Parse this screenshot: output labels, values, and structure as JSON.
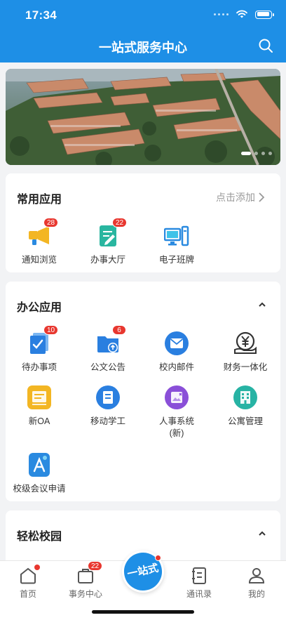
{
  "status_bar": {
    "time": "17:34"
  },
  "nav": {
    "title": "一站式服务中心"
  },
  "banner": {
    "slides": 4,
    "active": 1
  },
  "common_apps": {
    "title": "常用应用",
    "action": "点击添加",
    "items": [
      {
        "label": "通知浏览",
        "badge": "28",
        "icon": "megaphone-icon"
      },
      {
        "label": "办事大厅",
        "badge": "22",
        "icon": "document-edit-icon"
      },
      {
        "label": "电子班牌",
        "badge": "",
        "icon": "desktop-computer-icon"
      }
    ]
  },
  "office_apps": {
    "title": "办公应用",
    "items": [
      {
        "label": "待办事项",
        "badge": "10",
        "icon": "todo-check-icon"
      },
      {
        "label": "公文公告",
        "badge": "6",
        "icon": "folder-upload-icon"
      },
      {
        "label": "校内邮件",
        "badge": "",
        "icon": "mail-icon"
      },
      {
        "label": "财务一体化",
        "badge": "",
        "icon": "finance-yen-icon"
      },
      {
        "label": "新OA",
        "badge": "",
        "icon": "oa-box-icon"
      },
      {
        "label": "移动学工",
        "badge": "",
        "icon": "student-work-icon"
      },
      {
        "label": "人事系统\n(新)",
        "badge": "",
        "icon": "hr-system-icon"
      },
      {
        "label": "公寓管理",
        "badge": "",
        "icon": "apartment-icon"
      },
      {
        "label": "校级会议申请",
        "badge": "",
        "icon": "meeting-app-icon"
      }
    ]
  },
  "campus": {
    "title": "轻松校园"
  },
  "tabbar": {
    "home": "首页",
    "service": "事务中心",
    "service_badge": "22",
    "center": "一站式",
    "contacts": "通讯录",
    "mine": "我的"
  },
  "colors": {
    "primary": "#1e8fe6",
    "badge": "#e8372f"
  }
}
